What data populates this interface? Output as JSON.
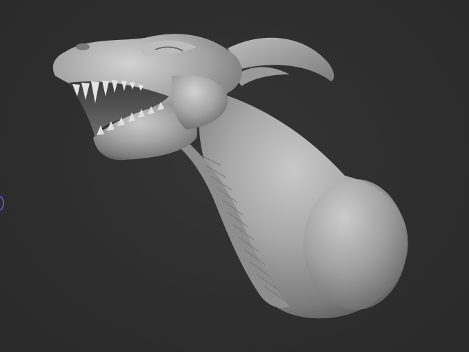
{
  "viewport": {
    "background_color": "#2f2f2f",
    "model_color": "#a9a9a9",
    "cursor_color": "#6a4fc4"
  },
  "model": {
    "icon": "dragon-head-sculpt"
  }
}
